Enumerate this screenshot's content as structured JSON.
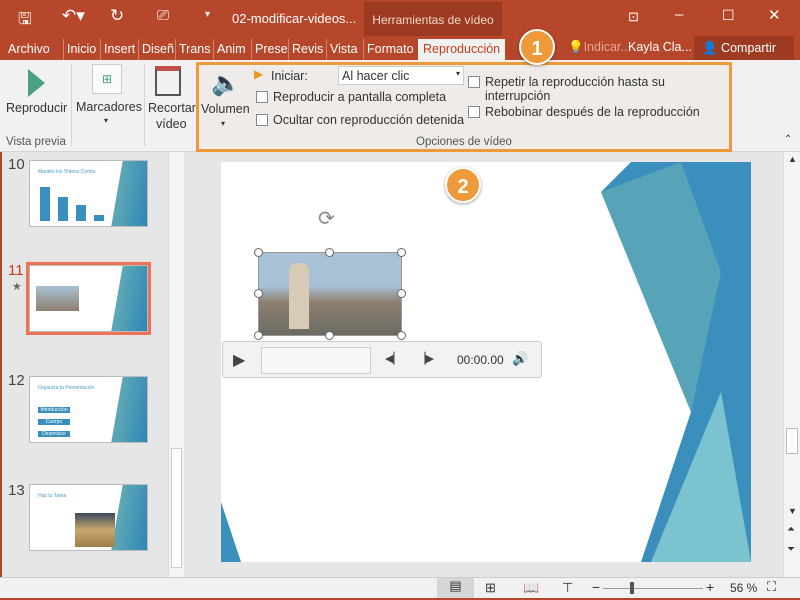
{
  "titlebar": {
    "filename": "02-modificar-videos...",
    "context_tab": "Herramientas de vídeo",
    "icons": [
      "save-icon",
      "undo-icon",
      "redo-icon",
      "present-icon",
      "customize-icon",
      "ribbon-options-icon",
      "minimize-icon",
      "maximize-icon",
      "close-icon"
    ]
  },
  "tabs": [
    "Archivo",
    "Inicio",
    "Insert",
    "Diseñ",
    "Trans",
    "Anim",
    "Prese",
    "Revis",
    "Vista",
    "Formato",
    "Reproducción"
  ],
  "tell_me": "Indicar...",
  "user": "Kayla Cla...",
  "share": "Compartir",
  "ribbon": {
    "play": "Reproducir",
    "bookmarks": "Marcadores",
    "trim1": "Recortar",
    "trim2": "vídeo",
    "group_preview": "Vista previa",
    "volume": "Volumen",
    "start_label": "Iniciar:",
    "start_value": "Al hacer clic",
    "fullscreen": "Reproducir a pantalla completa",
    "hide": "Ocultar con reproducción detenida",
    "loop": "Repetir la reproducción hasta su interrupción",
    "rewind": "Rebobinar después de la reproducción",
    "group_video": "Opciones de vídeo"
  },
  "slides": [
    {
      "num": "10",
      "title": "Mantén los Vídeos Cortos"
    },
    {
      "num": "11",
      "title": ""
    },
    {
      "num": "12",
      "title": "Organiza tu Presentación",
      "items": [
        "Introducción",
        "Cuerpo",
        "Desenlace"
      ]
    },
    {
      "num": "13",
      "title": "Haz tu Tarea"
    }
  ],
  "player": {
    "time": "00:00.00"
  },
  "callouts": [
    "1",
    "2"
  ],
  "status": {
    "zoom": "56 %",
    "zoom_fraction": 0.56
  },
  "colors": {
    "accent": "#b7472a",
    "callout": "#ef9a3a",
    "selected": "#ef7256"
  }
}
